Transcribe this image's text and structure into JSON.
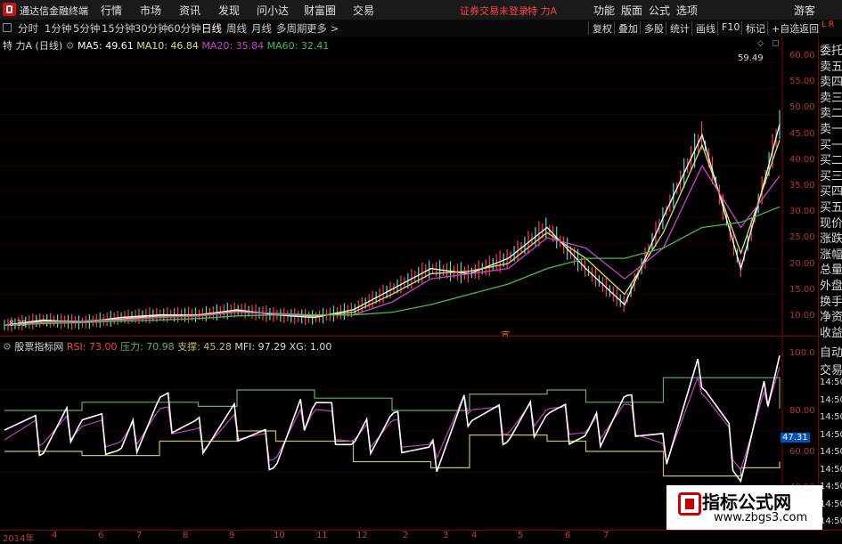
{
  "topbar": {
    "app_title": "通达信金融终端",
    "menu": [
      "行情",
      "市场",
      "资讯",
      "发现",
      "问小达",
      "财富圈",
      "交易"
    ],
    "login_status": "证券交易未登录",
    "stock_name": "特 力A",
    "right_menu": [
      "功能",
      "版面",
      "公式",
      "选项"
    ],
    "guest": "游客"
  },
  "periods": [
    "分时",
    "1分钟",
    "5分钟",
    "15分钟",
    "30分钟",
    "60分钟",
    "日线",
    "周线",
    "月线",
    "多周期",
    "更多 >"
  ],
  "active_period": "日线",
  "toolbar_right": [
    "复权",
    "叠加",
    "多股",
    "统计",
    "画线",
    "F10",
    "标记",
    "+自选",
    "返回"
  ],
  "main_legend": {
    "name": "特 力A",
    "period": "(日线)",
    "ma5": "MA5: 49.61",
    "ma10": "MA10: 46.84",
    "ma20": "MA20: 35.84",
    "ma60": "MA60: 32.41"
  },
  "price_axis": [
    "60.00",
    "55.00",
    "50.00",
    "45.00",
    "40.00",
    "35.00",
    "30.00",
    "25.00",
    "20.00",
    "15.00",
    "10.00"
  ],
  "high_label": "59.49",
  "low_label": "8.39",
  "marker_char": "宣",
  "rsi_legend": {
    "name": "股票指标网",
    "rsi": "RSI: 73.00",
    "pressure": "压力: 70.98",
    "support": "支撑: 45.28",
    "mfi": "MFI: 97.29",
    "xg": "XG: 1.00"
  },
  "rsi_axis": [
    "100.0",
    "80.00",
    "60.00",
    "40.00"
  ],
  "rsi_current": "47.31",
  "time_axis": [
    "2014年",
    "4",
    "6",
    "7",
    "8",
    "9",
    "10",
    "11",
    "12",
    "2",
    "3",
    "4",
    "5",
    "6",
    "7"
  ],
  "sidebar": [
    "委托",
    "卖五",
    "卖四",
    "卖三",
    "卖二",
    "卖一",
    "买一",
    "买二",
    "买三",
    "买四",
    "买五",
    "现价",
    "涨跌",
    "涨幅",
    "总量",
    "外盘",
    "换手",
    "净资",
    "收益"
  ],
  "sidebar_lower": [
    "自动",
    "交易",
    "14:50",
    "14:50",
    "14:50",
    "14:50",
    "14:50",
    "14:50",
    "14:50",
    "14:50",
    "14:50"
  ],
  "watermark": {
    "title": "指标公式网",
    "url": "www.zbgs3.com"
  },
  "colors": {
    "ma5": "#ffffff",
    "ma10": "#e0e060",
    "ma20": "#d040d0",
    "ma60": "#40c040",
    "rsi": "#ffffff",
    "pressure": "#60b060",
    "support": "#c0c060",
    "mfi": "#c040c0",
    "axis": "#8a0000"
  },
  "chart_data": [
    {
      "type": "line",
      "title": "特 力A (日线)",
      "ylim": [
        8,
        62
      ],
      "x": [
        0,
        5,
        10,
        15,
        20,
        25,
        30,
        35,
        40,
        45,
        50,
        55,
        60,
        65,
        70,
        75,
        80,
        85,
        90,
        95,
        100
      ],
      "series": [
        {
          "name": "MA5",
          "values": [
            9,
            10,
            9.5,
            10.5,
            11,
            11,
            12,
            11,
            10.5,
            12,
            16,
            20,
            19,
            22,
            28,
            20,
            13,
            30,
            46,
            20,
            48
          ]
        },
        {
          "name": "MA10",
          "values": [
            9,
            9.8,
            9.8,
            10.2,
            10.8,
            11,
            11.8,
            11.2,
            10.8,
            11.5,
            15,
            19,
            19.5,
            21,
            27,
            22,
            15,
            27,
            44,
            23,
            45
          ]
        },
        {
          "name": "MA20",
          "values": [
            9,
            9.5,
            9.8,
            10,
            10.5,
            10.8,
            11.5,
            11.3,
            11,
            11,
            13.5,
            18,
            19,
            20,
            26,
            24,
            18,
            24,
            40,
            28,
            38
          ]
        },
        {
          "name": "MA60",
          "values": [
            9,
            9.3,
            9.5,
            9.8,
            10,
            10.3,
            10.8,
            11,
            11,
            11,
            11.5,
            13,
            15,
            17,
            20,
            22,
            22,
            24,
            28,
            29,
            32
          ]
        }
      ]
    },
    {
      "type": "line",
      "title": "股票指标网",
      "ylim": [
        30,
        100
      ],
      "series": [
        {
          "name": "RSI",
          "values": [
            70,
            55,
            68,
            50,
            72,
            58,
            64,
            48,
            76,
            52,
            64,
            44,
            73,
            60,
            70,
            56,
            72,
            50,
            90,
            40,
            98
          ]
        },
        {
          "name": "压力",
          "values": [
            70,
            70,
            74,
            74,
            74,
            72,
            80,
            80,
            76,
            76,
            70,
            70,
            78,
            78,
            80,
            74,
            74,
            86,
            86,
            86,
            71
          ]
        },
        {
          "name": "支撑",
          "values": [
            50,
            50,
            48,
            48,
            55,
            55,
            60,
            55,
            55,
            45,
            45,
            42,
            58,
            58,
            55,
            50,
            50,
            38,
            38,
            42,
            45
          ]
        },
        {
          "name": "MFI",
          "values": [
            62,
            58,
            64,
            54,
            68,
            56,
            62,
            50,
            72,
            54,
            62,
            48,
            76,
            62,
            72,
            58,
            70,
            48,
            84,
            44,
            92
          ]
        }
      ]
    }
  ]
}
